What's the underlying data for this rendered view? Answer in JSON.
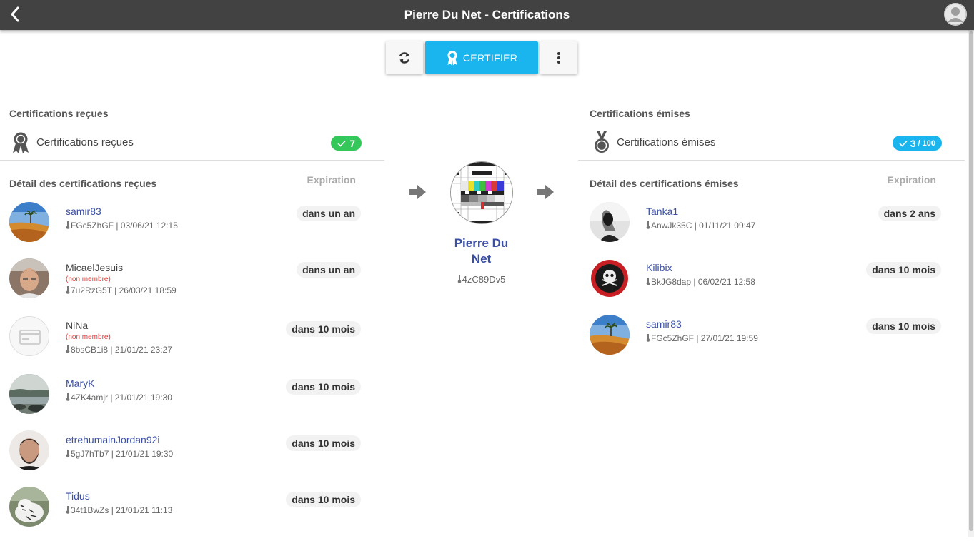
{
  "header": {
    "title": "Pierre Du Net - Certifications"
  },
  "toolbar": {
    "certify_label": "CERTIFIER"
  },
  "received": {
    "section_title": "Certifications reçues",
    "summary_label": "Certifications reçues",
    "badge": "7",
    "detail_title": "Détail des certifications reçues",
    "expiration_header": "Expiration",
    "items": [
      {
        "name": "samir83",
        "member": true,
        "non_member_label": "",
        "meta": "FGc5ZhGF | 03/06/21 12:15",
        "expiration": "dans un an"
      },
      {
        "name": "MicaelJesuis",
        "member": false,
        "non_member_label": "(non membre)",
        "meta": "7u2RzG5T | 26/03/21 18:59",
        "expiration": "dans un an"
      },
      {
        "name": "NiNa",
        "member": false,
        "non_member_label": "(non membre)",
        "meta": "8bsCB1i8 | 21/01/21 23:27",
        "expiration": "dans 10 mois"
      },
      {
        "name": "MaryK",
        "member": true,
        "non_member_label": "",
        "meta": "4ZK4amjr | 21/01/21 19:30",
        "expiration": "dans 10 mois"
      },
      {
        "name": "etrehumainJordan92i",
        "member": true,
        "non_member_label": "",
        "meta": "5gJ7hTb7 | 21/01/21 19:30",
        "expiration": "dans 10 mois"
      },
      {
        "name": "Tidus",
        "member": true,
        "non_member_label": "",
        "meta": "34t1BwZs | 21/01/21 11:13",
        "expiration": "dans 10 mois"
      }
    ]
  },
  "issued": {
    "section_title": "Certifications émises",
    "summary_label": "Certifications émises",
    "badge_count": "3",
    "badge_total": "/ 100",
    "detail_title": "Détail des certifications émises",
    "expiration_header": "Expiration",
    "items": [
      {
        "name": "Tanka1",
        "member": true,
        "meta": "AnwJk35C | 01/11/21 09:47",
        "expiration": "dans 2 ans"
      },
      {
        "name": "Kilibix",
        "member": true,
        "meta": "BkJG8dap | 06/02/21 12:58",
        "expiration": "dans 10 mois"
      },
      {
        "name": "samir83",
        "member": true,
        "meta": "FGc5ZhGF | 27/01/21 19:59",
        "expiration": "dans 10 mois"
      }
    ]
  },
  "identity": {
    "name_line1": "Pierre Du",
    "name_line2": "Net",
    "pubkey": "4zC89Dv5"
  },
  "colors": {
    "header_bg": "#424242",
    "accent": "#1ab5ee",
    "success": "#34c759",
    "link": "#3a4fa6",
    "warning": "#e53935"
  }
}
